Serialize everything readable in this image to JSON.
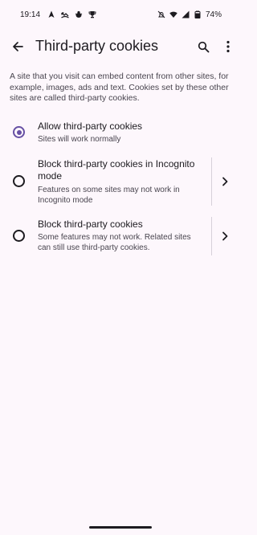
{
  "status_bar": {
    "time": "19:14",
    "battery": "74%"
  },
  "app_bar": {
    "title": "Third-party cookies"
  },
  "description": "A site that you visit can embed content from other sites, for example, images, ads and text. Cookies set by these other sites are called third-party cookies.",
  "options": [
    {
      "title": "Allow third-party cookies",
      "subtitle": "Sites will work normally",
      "selected": true
    },
    {
      "title_line1": "Block third-party cookies in Incognito",
      "title_line2": "mode",
      "subtitle_line1": "Features on some sites may not work in",
      "subtitle_line2": "Incognito mode",
      "selected": false
    },
    {
      "title": "Block third-party cookies",
      "subtitle_line1": "Some features may not work. Related sites",
      "subtitle_line2": "can still use third-party cookies.",
      "selected": false
    }
  ],
  "colors": {
    "background": "#fdf7fc",
    "accent": "#6750a4",
    "text_primary": "#1d1b20",
    "text_secondary": "#49454f"
  },
  "icons": [
    "navigation-icon",
    "missed-call-icon",
    "bug-icon",
    "trophy-icon",
    "mute-icon",
    "wifi-icon",
    "signal-icon",
    "battery-icon",
    "back-arrow-icon",
    "search-icon",
    "more-vert-icon",
    "chevron-right-icon"
  ]
}
